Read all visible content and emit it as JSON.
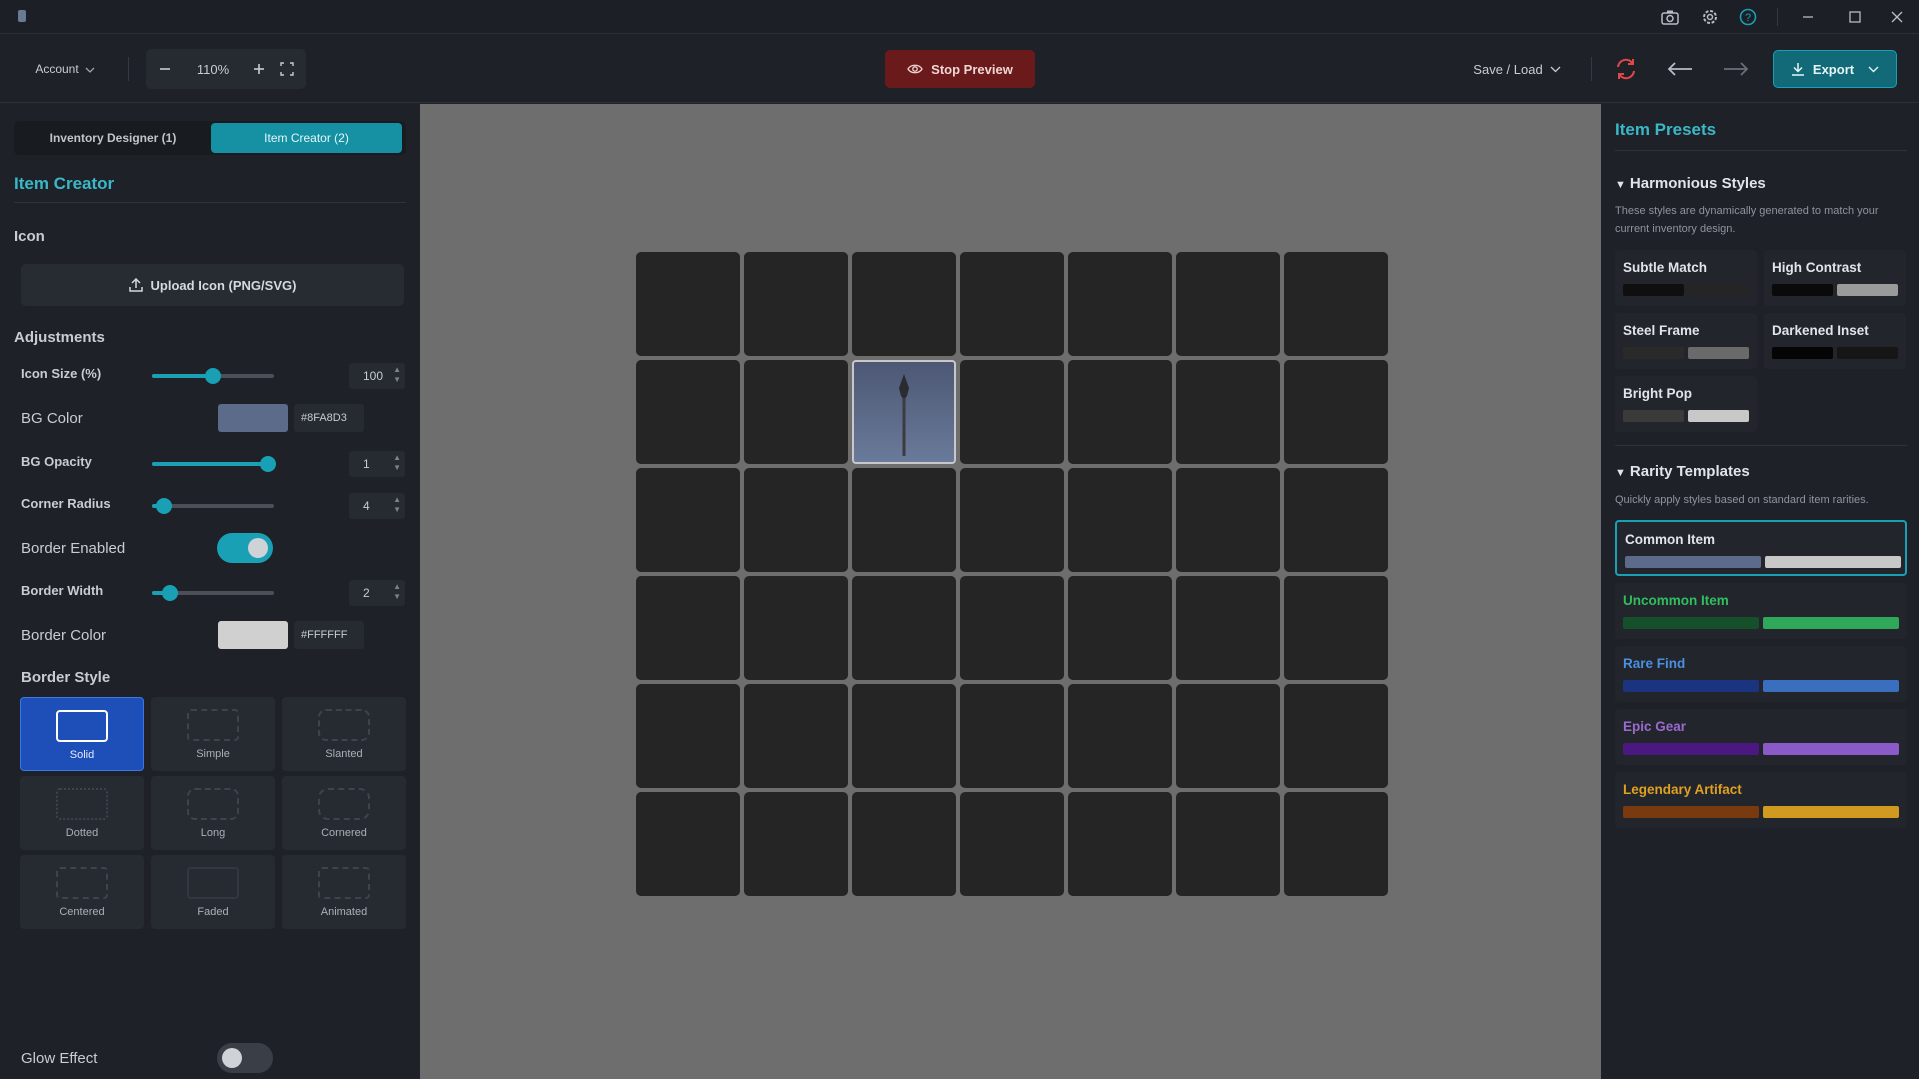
{
  "toolbar": {
    "account_label": "Account",
    "zoom_level": "110%",
    "stop_preview_label": "Stop Preview",
    "save_load_label": "Save / Load",
    "export_label": "Export"
  },
  "left_panel": {
    "tabs": [
      {
        "label": "Inventory Designer (1)",
        "active": false
      },
      {
        "label": "Item Creator (2)",
        "active": true
      }
    ],
    "title": "Item Creator",
    "icon_section": "Icon",
    "upload_label": "Upload Icon (PNG/SVG)",
    "adjustments_section": "Adjustments",
    "icon_size": {
      "label": "Icon Size (%)",
      "value": "100",
      "fraction": 0.5
    },
    "bg_color": {
      "label": "BG Color",
      "hex": "#8FA8D3",
      "swatch": "#5c6b8a"
    },
    "bg_opacity": {
      "label": "BG Opacity",
      "value": "1",
      "fraction": 1.0
    },
    "corner_radius": {
      "label": "Corner Radius",
      "value": "4",
      "fraction": 0.1
    },
    "border_enabled": {
      "label": "Border Enabled",
      "on": true
    },
    "border_width": {
      "label": "Border Width",
      "value": "2",
      "fraction": 0.15
    },
    "border_color": {
      "label": "Border Color",
      "hex": "#FFFFFF",
      "swatch": "#d0d0d0"
    },
    "border_style": {
      "label": "Border Style",
      "options": [
        "Solid",
        "Simple",
        "Slanted",
        "Dotted",
        "Long",
        "Cornered",
        "Centered",
        "Faded",
        "Animated"
      ],
      "selected": "Solid"
    },
    "glow_effect": {
      "label": "Glow Effect",
      "on": false
    }
  },
  "canvas": {
    "grid_columns": 7,
    "grid_rows": 6,
    "item_cell": {
      "row": 2,
      "col": 3,
      "icon": "spear-icon"
    }
  },
  "right_panel": {
    "title": "Item Presets",
    "harmonious": {
      "title": "Harmonious Styles",
      "description": "These styles are dynamically generated to match your current inventory design.",
      "presets": [
        {
          "name": "Subtle Match",
          "colors": [
            "#0f0f0f",
            "#252525"
          ]
        },
        {
          "name": "High Contrast",
          "colors": [
            "#0a0a0a",
            "#9a9a9a"
          ]
        },
        {
          "name": "Steel Frame",
          "colors": [
            "#2a2a2a",
            "#6a6a6a"
          ]
        },
        {
          "name": "Darkened Inset",
          "colors": [
            "#050505",
            "#161616"
          ]
        },
        {
          "name": "Bright Pop",
          "colors": [
            "#3a3a3a",
            "#c8c8c8"
          ]
        }
      ]
    },
    "rarity": {
      "title": "Rarity Templates",
      "description": "Quickly apply styles based on standard item rarities.",
      "templates": [
        {
          "name": "Common Item",
          "color": "#e1e4e8",
          "colors": [
            "#5c6b8a",
            "#c8c8c8"
          ],
          "selected": true
        },
        {
          "name": "Uncommon Item",
          "color": "#2fbf5f",
          "colors": [
            "#16502a",
            "#2fa85a"
          ],
          "selected": false
        },
        {
          "name": "Rare Find",
          "color": "#4a8fe0",
          "colors": [
            "#1a3480",
            "#3a6fc0"
          ],
          "selected": false
        },
        {
          "name": "Epic Gear",
          "color": "#9a6ad0",
          "colors": [
            "#4a1880",
            "#8a5ac8"
          ],
          "selected": false
        },
        {
          "name": "Legendary Artifact",
          "color": "#e0a020",
          "colors": [
            "#7a3a10",
            "#d09a20"
          ],
          "selected": false
        }
      ]
    }
  },
  "colors": {
    "accent": "#1aa0b4",
    "stop_preview_bg": "#6a1a1a",
    "selected_style": "#1e4fb8"
  }
}
